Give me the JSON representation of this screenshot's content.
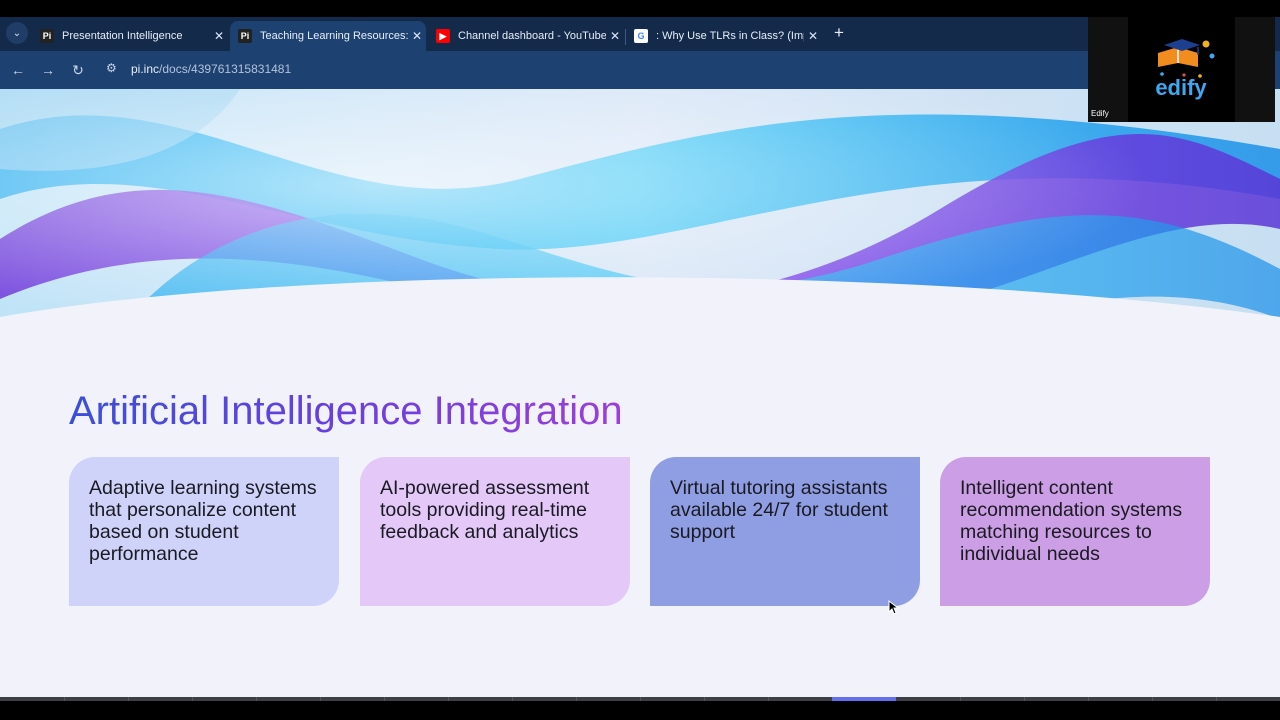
{
  "browser": {
    "tabs": [
      {
        "label": "Presentation Intelligence",
        "favicon": "Pi",
        "favicon_icon": "pi-favicon-icon",
        "active": false
      },
      {
        "label": "Teaching Learning Resources: Ty",
        "favicon": "Pi",
        "favicon_icon": "pi-favicon-icon",
        "active": true
      },
      {
        "label": "Channel dashboard - YouTube S",
        "favicon": "▶",
        "favicon_icon": "youtube-favicon-icon",
        "active": false
      },
      {
        "label": ": Why Use TLRs in Class? (Impor",
        "favicon": "G",
        "favicon_icon": "google-favicon-icon",
        "active": false
      }
    ],
    "new_tab_label": "+",
    "tab_close": "✕",
    "tab_menu_icon": "⌄",
    "nav": {
      "back": "←",
      "forward": "→",
      "reload": "↻",
      "site_info": "⚙"
    },
    "url": {
      "host": "pi.inc",
      "path": "/docs/439761315831481"
    },
    "colors": {
      "tabstrip": "#132a4a",
      "toolbar": "#1d4170"
    }
  },
  "slide": {
    "title": "Artificial Intelligence Integration",
    "cards": [
      {
        "text": "Adaptive learning systems that personalize content based on student performance",
        "color": "#cfd3f9"
      },
      {
        "text": "AI-powered assessment tools providing real-time feedback and analytics",
        "color": "#e3c8f8"
      },
      {
        "text": "Virtual tutoring assistants available 24/7 for student support",
        "color": "#8f9de3"
      },
      {
        "text": "Intelligent content recommendation systems matching resources to individual needs",
        "color": "#cc9ee5"
      }
    ]
  },
  "webcam": {
    "name": "Edify",
    "logo": "edify",
    "logo_icon": "edify-logo-icon"
  },
  "progress": {
    "current_slide_fraction": 0.7
  }
}
